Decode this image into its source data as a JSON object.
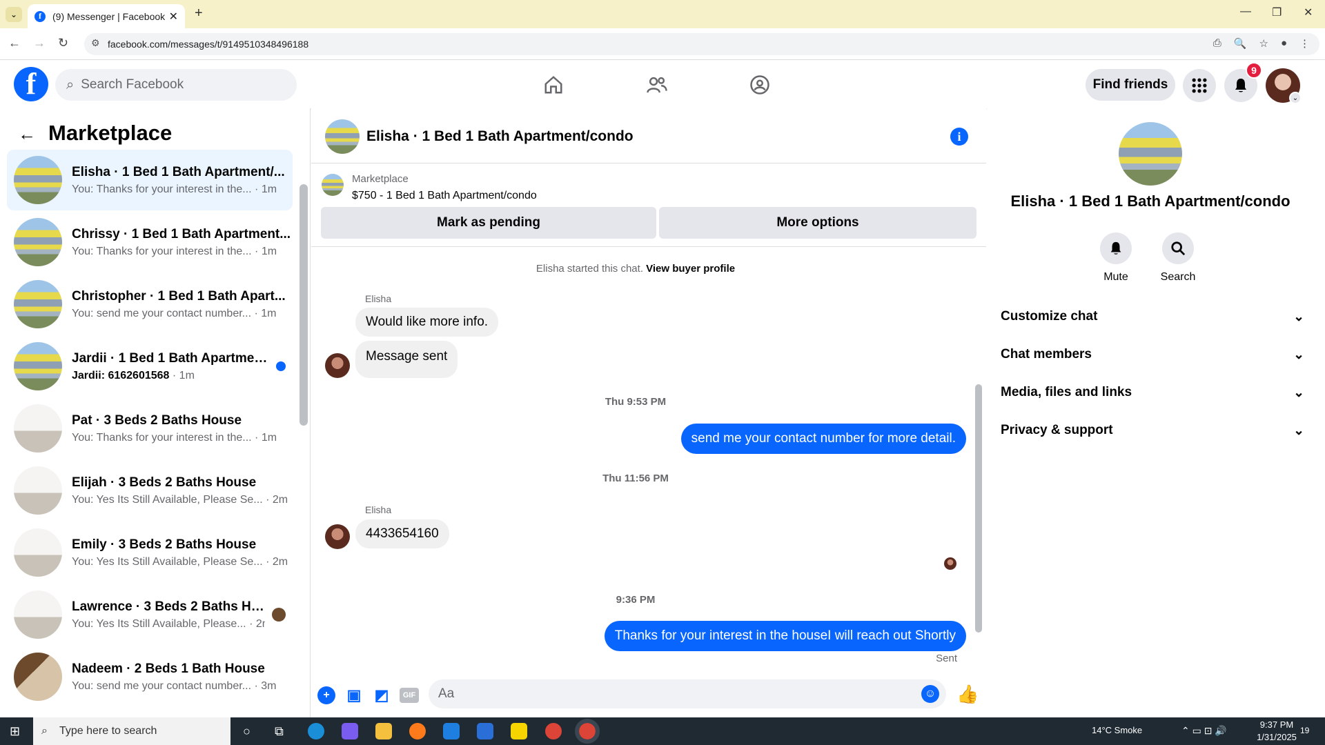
{
  "browser": {
    "tab_title": "(9) Messenger | Facebook",
    "url": "facebook.com/messages/t/9149510348496188"
  },
  "header": {
    "search_placeholder": "Search Facebook",
    "find_friends": "Find friends",
    "notif_count": "9"
  },
  "left": {
    "title": "Marketplace",
    "conversations": [
      {
        "name": "Elisha · 1 Bed 1 Bath Apartment/...",
        "preview": "You: Thanks for your interest in the...",
        "time": "1m",
        "thumb": "apt"
      },
      {
        "name": "Chrissy · 1 Bed 1 Bath Apartment...",
        "preview": "You: Thanks for your interest in the...",
        "time": "1m",
        "thumb": "apt"
      },
      {
        "name": "Christopher · 1 Bed 1 Bath Apart...",
        "preview": "You: send me your contact number...",
        "time": "1m",
        "thumb": "apt"
      },
      {
        "name": "Jardii · 1 Bed 1 Bath Apartment...",
        "preview": "Jardii: 6162601568",
        "time": "1m",
        "thumb": "apt",
        "unread": true
      },
      {
        "name": "Pat · 3 Beds 2 Baths House",
        "preview": "You: Thanks for your interest in the...",
        "time": "1m",
        "thumb": "room"
      },
      {
        "name": "Elijah · 3 Beds 2 Baths House",
        "preview": "You: Yes Its Still Available, Please Se...",
        "time": "2m",
        "thumb": "room"
      },
      {
        "name": "Emily · 3 Beds 2 Baths House",
        "preview": "You: Yes Its Still Available, Please Se...",
        "time": "2m",
        "thumb": "room"
      },
      {
        "name": "Lawrence · 3 Beds 2 Baths Ho...",
        "preview": "You: Yes Its Still Available, Please...",
        "time": "2m",
        "thumb": "room",
        "seen": true
      },
      {
        "name": "Nadeem · 2 Beds 1 Bath House",
        "preview": "You: send me your contact number...",
        "time": "3m",
        "thumb": "bath"
      }
    ]
  },
  "chat": {
    "title": "Elisha · 1 Bed 1 Bath Apartment/condo",
    "listing_label": "Marketplace",
    "listing_price": "$750 - 1 Bed 1 Bath Apartment/condo",
    "mark_pending": "Mark as pending",
    "more_options": "More options",
    "started_text": "Elisha started this chat.",
    "view_profile": "View buyer profile",
    "sender1": "Elisha",
    "msg1": "Would like more info.",
    "msg2": "Message sent",
    "time1": "Thu 9:53 PM",
    "msg3": "send me your contact number for more detail.",
    "time2": "Thu 11:56 PM",
    "sender2": "Elisha",
    "msg4": "4433654160",
    "time3": "9:36 PM",
    "msg5": "Thanks for your interest in the houseI will reach out Shortly",
    "status": "Sent",
    "input_placeholder": "Aa"
  },
  "right": {
    "name": "Elisha · 1 Bed 1 Bath Apartment/condo",
    "mute": "Mute",
    "search": "Search",
    "items": [
      "Customize chat",
      "Chat members",
      "Media, files and links",
      "Privacy & support"
    ]
  },
  "taskbar": {
    "search": "Type here to search",
    "weather": "14°C  Smoke",
    "time": "9:37 PM",
    "date": "1/31/2025",
    "notif": "19"
  }
}
